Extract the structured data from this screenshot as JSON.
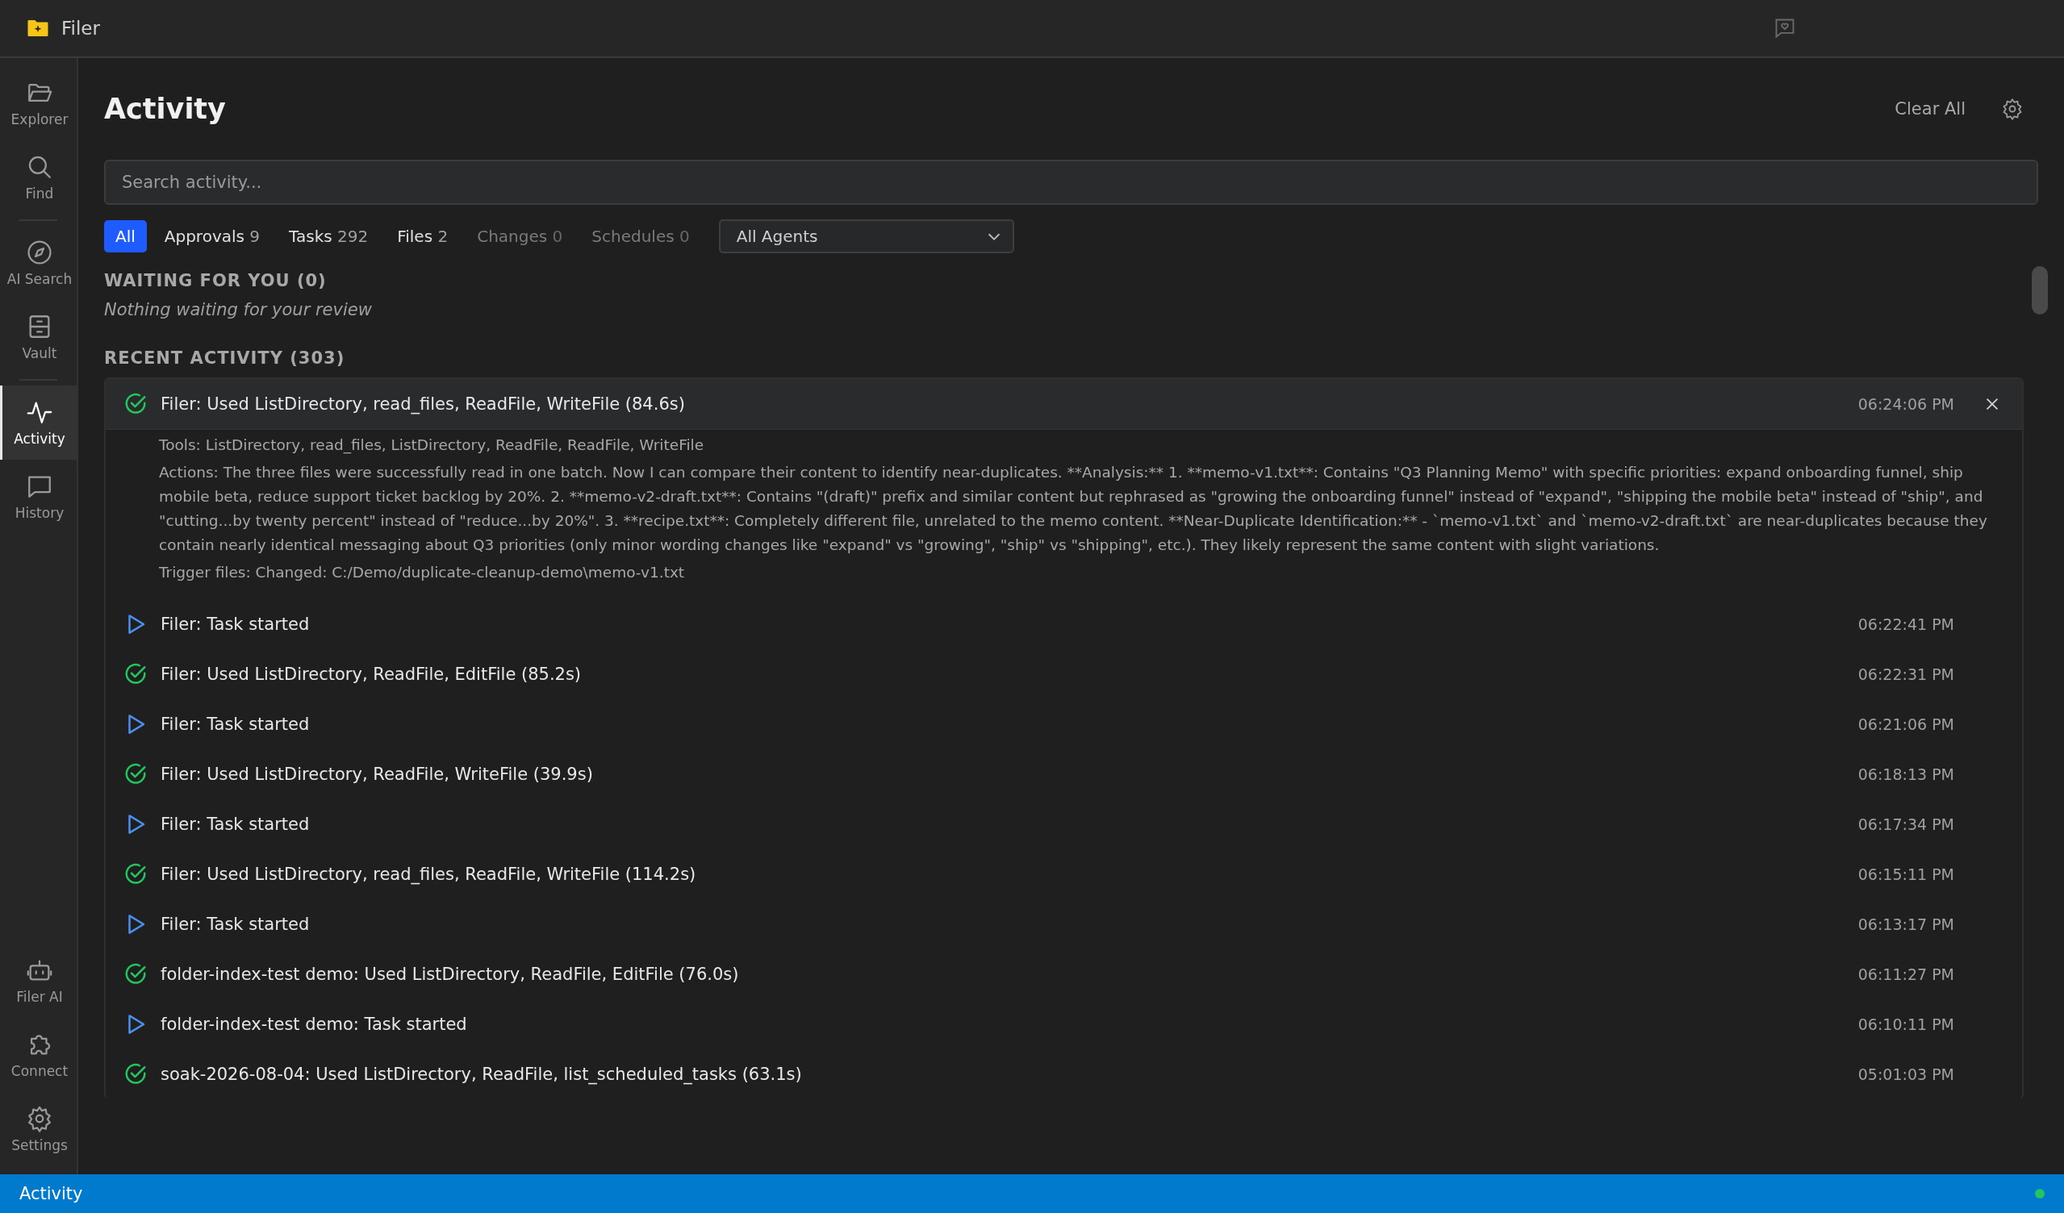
{
  "window": {
    "title": "Filer"
  },
  "sidebar": {
    "groups": [
      [
        {
          "label": "Explorer",
          "kind": "folder",
          "selected": false
        },
        {
          "label": "Find",
          "kind": "search",
          "selected": false
        }
      ],
      [
        {
          "label": "AI Search",
          "kind": "compass",
          "selected": false
        },
        {
          "label": "Vault",
          "kind": "vault",
          "selected": false
        }
      ],
      [
        {
          "label": "Activity",
          "kind": "activity",
          "selected": true
        },
        {
          "label": "History",
          "kind": "chat",
          "selected": false
        }
      ]
    ],
    "bottom_items": [
      {
        "label": "Filer AI",
        "kind": "robot",
        "selected": false
      },
      {
        "label": "Connect",
        "kind": "puzzle",
        "selected": false
      },
      {
        "label": "Settings",
        "kind": "gear",
        "selected": false
      }
    ]
  },
  "page": {
    "title": "Activity",
    "clear_button": "Clear All"
  },
  "search": {
    "placeholder": "Search activity..."
  },
  "filters": [
    {
      "label": "All",
      "selected": true,
      "disabled": false
    },
    {
      "label": "Approvals",
      "count": "9",
      "selected": false,
      "disabled": false
    },
    {
      "label": "Tasks",
      "count": "292",
      "selected": false,
      "disabled": false
    },
    {
      "label": "Files",
      "count": "2",
      "selected": false,
      "disabled": false
    },
    {
      "label": "Changes",
      "count": "0",
      "selected": false,
      "disabled": true
    },
    {
      "label": "Schedules",
      "count": "0",
      "selected": false,
      "disabled": true
    }
  ],
  "agent_select": {
    "value": "All Agents"
  },
  "waiting": {
    "heading": "WAITING FOR YOU (0)",
    "empty_text": "Nothing waiting for your review"
  },
  "recent": {
    "heading": "RECENT ACTIVITY (303)",
    "items": [
      {
        "kind": "done",
        "text": "Filer: Used ListDirectory, read_files, ReadFile, WriteFile (84.6s)",
        "time": "06:24:06 PM",
        "expanded": true,
        "details": [
          "Tools: ListDirectory, read_files, ListDirectory, ReadFile, ReadFile, WriteFile",
          "Actions: The three files were successfully read in one batch. Now I can compare their content to identify near-duplicates. **Analysis:** 1. **memo-v1.txt**: Contains \"Q3 Planning Memo\" with specific priorities: expand onboarding funnel, ship mobile beta, reduce support ticket backlog by 20%. 2. **memo-v2-draft.txt**: Contains \"(draft)\" prefix and similar content but rephrased as \"growing the onboarding funnel\" instead of \"expand\", \"shipping the mobile beta\" instead of \"ship\", and \"cutting...by twenty percent\" instead of \"reduce...by 20%\". 3. **recipe.txt**: Completely different file, unrelated to the memo content. **Near-Duplicate Identification:** - `memo-v1.txt` and `memo-v2-draft.txt` are near-duplicates because they contain nearly identical messaging about Q3 priorities (only minor wording changes like \"expand\" vs \"growing\", \"ship\" vs \"shipping\", etc.). They likely represent the same content with slight variations.",
          "Trigger files: Changed: C:/Demo/duplicate-cleanup-demo\\memo-v1.txt"
        ]
      },
      {
        "kind": "started",
        "text": "Filer: Task started",
        "time": "06:22:41 PM",
        "expanded": false
      },
      {
        "kind": "done",
        "text": "Filer: Used ListDirectory, ReadFile, EditFile (85.2s)",
        "time": "06:22:31 PM",
        "expanded": false
      },
      {
        "kind": "started",
        "text": "Filer: Task started",
        "time": "06:21:06 PM",
        "expanded": false
      },
      {
        "kind": "done",
        "text": "Filer: Used ListDirectory, ReadFile, WriteFile (39.9s)",
        "time": "06:18:13 PM",
        "expanded": false
      },
      {
        "kind": "started",
        "text": "Filer: Task started",
        "time": "06:17:34 PM",
        "expanded": false
      },
      {
        "kind": "done",
        "text": "Filer: Used ListDirectory, read_files, ReadFile, WriteFile (114.2s)",
        "time": "06:15:11 PM",
        "expanded": false
      },
      {
        "kind": "started",
        "text": "Filer: Task started",
        "time": "06:13:17 PM",
        "expanded": false
      },
      {
        "kind": "done",
        "text": "folder-index-test demo: Used ListDirectory, ReadFile, EditFile (76.0s)",
        "time": "06:11:27 PM",
        "expanded": false
      },
      {
        "kind": "started",
        "text": "folder-index-test demo: Task started",
        "time": "06:10:11 PM",
        "expanded": false
      },
      {
        "kind": "done",
        "text": "soak-2026-08-04: Used ListDirectory, ReadFile, list_scheduled_tasks (63.1s)",
        "time": "05:01:03 PM",
        "expanded": false
      }
    ]
  },
  "status_bar": {
    "text": "Activity",
    "connected": true
  }
}
